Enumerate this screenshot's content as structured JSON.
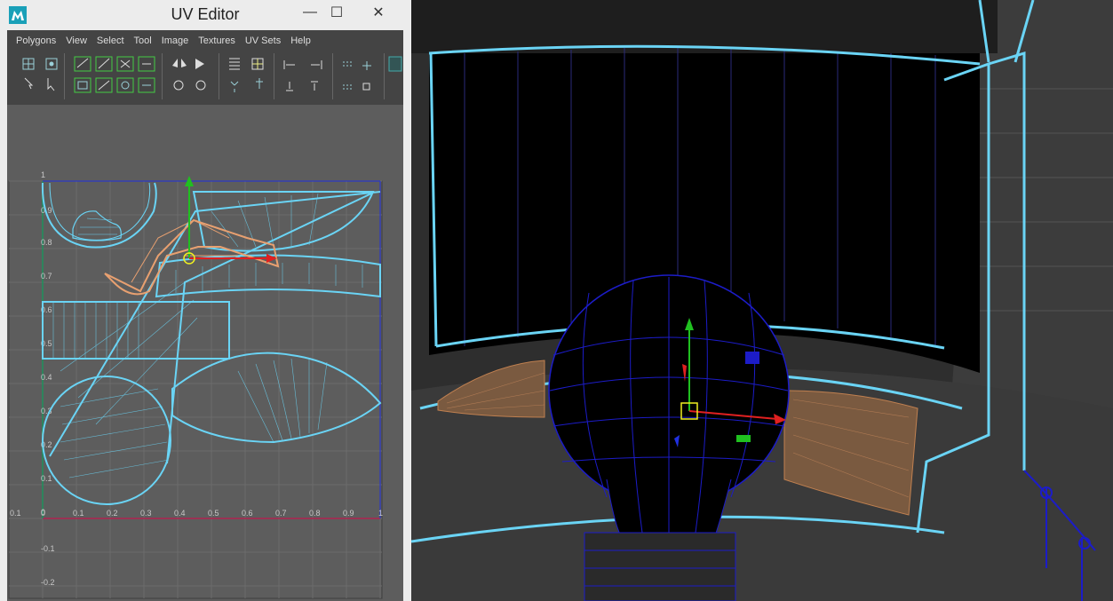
{
  "window": {
    "title": "UV Editor",
    "min_glyph": "—",
    "max_glyph": "☐",
    "close_glyph": "✕"
  },
  "menu": {
    "items": [
      "Polygons",
      "View",
      "Select",
      "Tool",
      "Image",
      "Textures",
      "UV Sets",
      "Help"
    ]
  },
  "uv_axes": {
    "x_ticks": [
      "0.1",
      "0",
      "0.1",
      "0.2",
      "0.3",
      "0.4",
      "0.5",
      "0.6",
      "0.7",
      "0.8",
      "0.9",
      "1"
    ],
    "y_ticks": [
      "1",
      "0.9",
      "0.8",
      "0.7",
      "0.6",
      "0.5",
      "0.4",
      "0.3",
      "0.2",
      "0.1",
      "0",
      "-0.1",
      "-0.2"
    ]
  },
  "colors": {
    "wire_cyan": "#6ad4f5",
    "wire_orange": "#e8a070",
    "axis_red": "#e02020",
    "axis_green": "#20c020",
    "axis_blue": "#2030e0",
    "grid_bg": "#5d5d5d",
    "viewport_wire": "#1c1cc8",
    "selected_face": "#c08050"
  },
  "icons": [
    "app-maya-icon",
    "uv-tool-icons"
  ]
}
